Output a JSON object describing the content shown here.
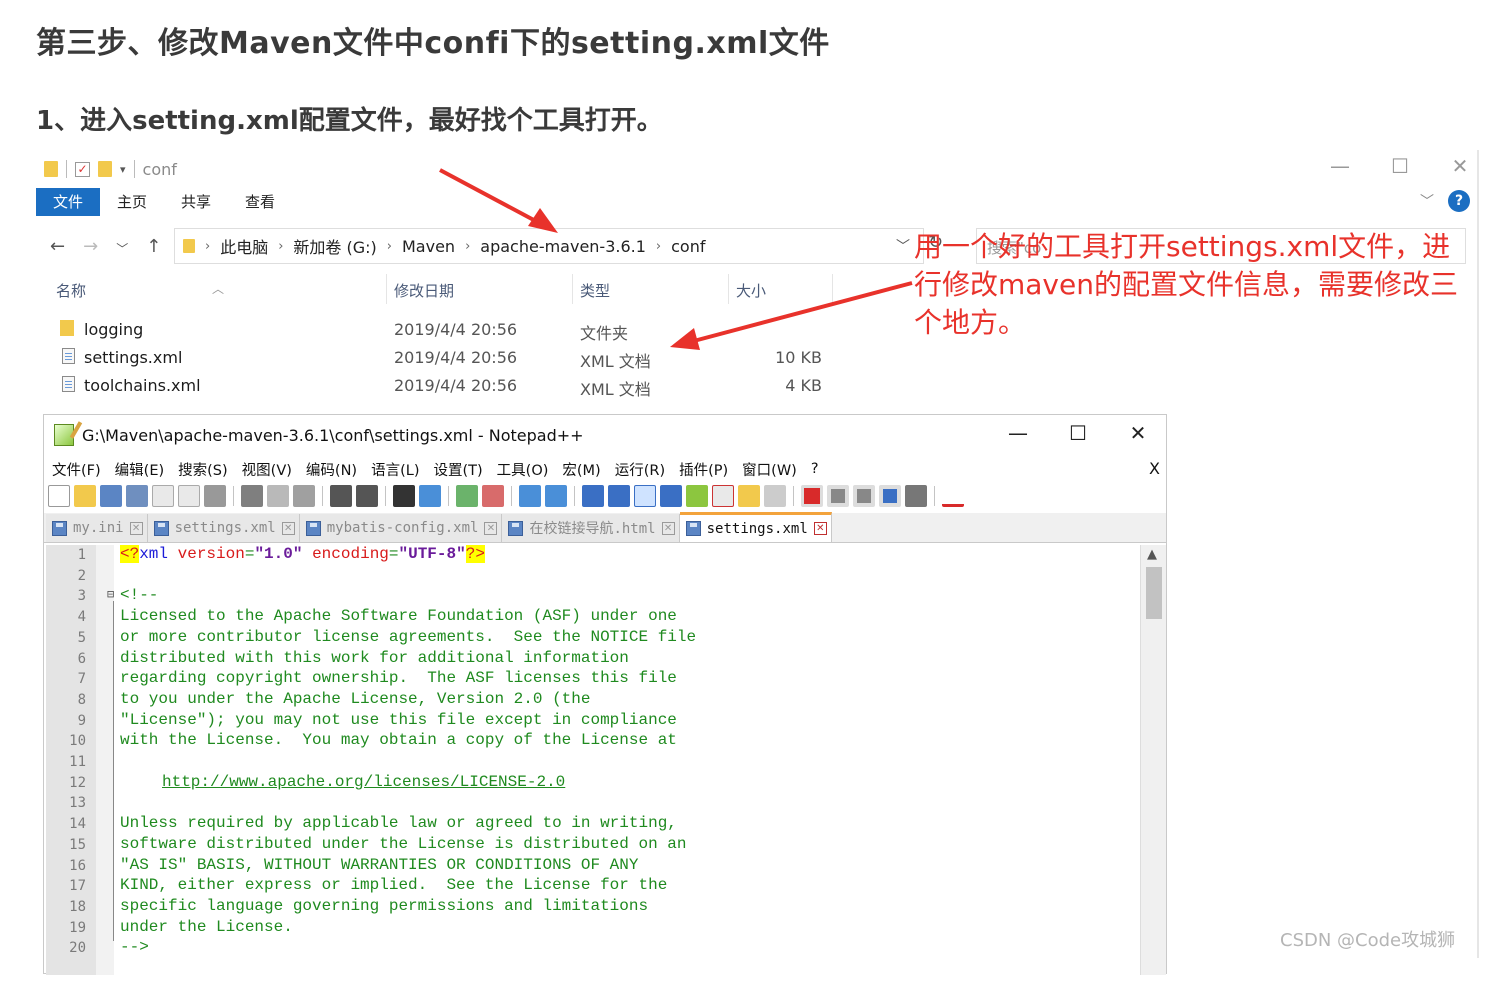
{
  "article": {
    "heading": "第三步、修改Maven文件中confi下的setting.xml文件",
    "step_heading": "1、进入setting.xml配置文件，最好找个工具打开。",
    "watermark": "CSDN @Code攻城狮"
  },
  "explorer": {
    "title": "conf",
    "ribbon_tabs": [
      "文件",
      "主页",
      "共享",
      "查看"
    ],
    "breadcrumb": [
      "此电脑",
      "新加卷 (G:)",
      "Maven",
      "apache-maven-3.6.1",
      "conf"
    ],
    "search_placeholder": "搜索\"co",
    "columns": {
      "name": "名称",
      "date": "修改日期",
      "type": "类型",
      "size": "大小"
    },
    "files": [
      {
        "name": "logging",
        "date": "2019/4/4 20:56",
        "type": "文件夹",
        "size": "",
        "icon": "folder-icon"
      },
      {
        "name": "settings.xml",
        "date": "2019/4/4 20:56",
        "type": "XML 文档",
        "size": "10 KB",
        "icon": "xml-file-icon"
      },
      {
        "name": "toolchains.xml",
        "date": "2019/4/4 20:56",
        "type": "XML 文档",
        "size": "4 KB",
        "icon": "xml-file-icon"
      }
    ]
  },
  "annotation": {
    "text": "用一个好的工具打开settings.xml文件，进行修改maven的配置文件信息，需要修改三个地方。",
    "color": "#e8322b"
  },
  "notepad": {
    "title": "G:\\Maven\\apache-maven-3.6.1\\conf\\settings.xml - Notepad++",
    "menu": [
      "文件(F)",
      "编辑(E)",
      "搜索(S)",
      "视图(V)",
      "编码(N)",
      "语言(L)",
      "设置(T)",
      "工具(O)",
      "宏(M)",
      "运行(R)",
      "插件(P)",
      "窗口(W)",
      "?"
    ],
    "menu_close": "X",
    "tabs": [
      {
        "label": "my.ini",
        "active": false
      },
      {
        "label": "settings.xml",
        "active": false
      },
      {
        "label": "mybatis-config.xml",
        "active": false
      },
      {
        "label": "在校链接导航.html",
        "active": false
      },
      {
        "label": "settings.xml",
        "active": true
      }
    ],
    "lines": [
      {
        "n": "1",
        "t": ""
      },
      {
        "n": "2",
        "t": ""
      },
      {
        "n": "3",
        "t": "<!--"
      },
      {
        "n": "4",
        "t": "Licensed to the Apache Software Foundation (ASF) under one"
      },
      {
        "n": "5",
        "t": "or more contributor license agreements.  See the NOTICE file"
      },
      {
        "n": "6",
        "t": "distributed with this work for additional information"
      },
      {
        "n": "7",
        "t": "regarding copyright ownership.  The ASF licenses this file"
      },
      {
        "n": "8",
        "t": "to you under the Apache License, Version 2.0 (the"
      },
      {
        "n": "9",
        "t": "\"License\"); you may not use this file except in compliance"
      },
      {
        "n": "10",
        "t": "with the License.  You may obtain a copy of the License at"
      },
      {
        "n": "11",
        "t": ""
      },
      {
        "n": "12",
        "t": ""
      },
      {
        "n": "13",
        "t": ""
      },
      {
        "n": "14",
        "t": "Unless required by applicable law or agreed to in writing,"
      },
      {
        "n": "15",
        "t": "software distributed under the License is distributed on an"
      },
      {
        "n": "16",
        "t": "\"AS IS\" BASIS, WITHOUT WARRANTIES OR CONDITIONS OF ANY"
      },
      {
        "n": "17",
        "t": "KIND, either express or implied.  See the License for the"
      },
      {
        "n": "18",
        "t": "specific language governing permissions and limitations"
      },
      {
        "n": "19",
        "t": "under the License."
      },
      {
        "n": "20",
        "t": "-->"
      }
    ],
    "xml_decl": {
      "open": "<?",
      "name": "xml",
      "version_attr": "version",
      "version_val": "\"1.0\"",
      "enc_attr": "encoding",
      "enc_val": "\"UTF-8\"",
      "close": "?>"
    },
    "license_url": "http://www.apache.org/licenses/LICENSE-2.0"
  }
}
